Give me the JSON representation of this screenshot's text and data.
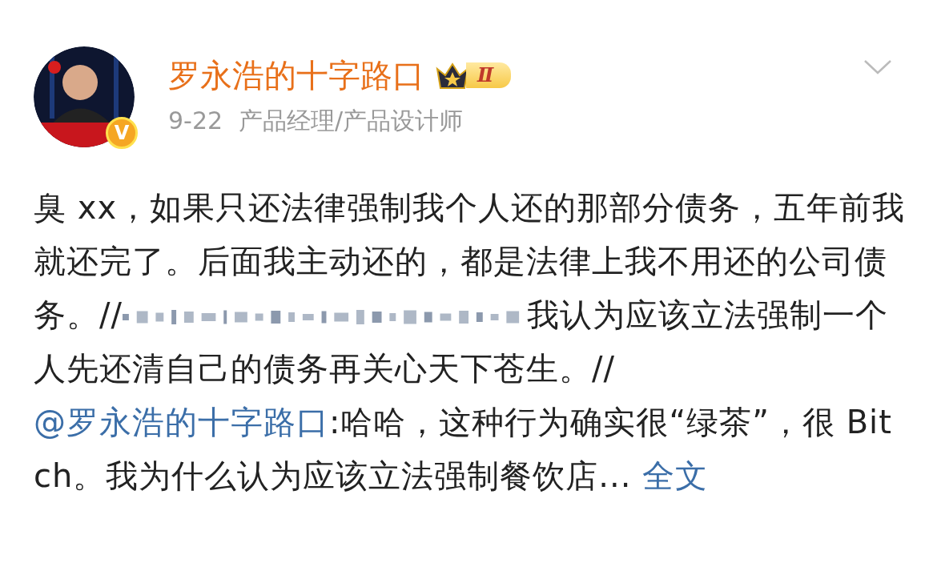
{
  "author": {
    "name": "罗永浩的十字路口",
    "verified_badge": "V",
    "level_badge": "Ⅱ",
    "date": "9-22",
    "title": "产品经理/产品设计师"
  },
  "post": {
    "segments": [
      {
        "kind": "text",
        "text": "臭 xx，如果只还法律强制我个人还的那部分债务，五年前我就还完了。后面我主动还的，都是法律上我不用还的公司债务。//"
      },
      {
        "kind": "redacted"
      },
      {
        "kind": "text",
        "text": "我认为应该立法强制一个人先还清自己的债务再关心天下苍生。//"
      },
      {
        "kind": "mention",
        "text": "@罗永浩的十字路口"
      },
      {
        "kind": "text",
        "text": ":哈哈，这种行为确实很“绿茶”，很 Bitch。我为什么认为应该立法强制餐饮店..."
      },
      {
        "kind": "more",
        "text": "全文"
      }
    ]
  }
}
